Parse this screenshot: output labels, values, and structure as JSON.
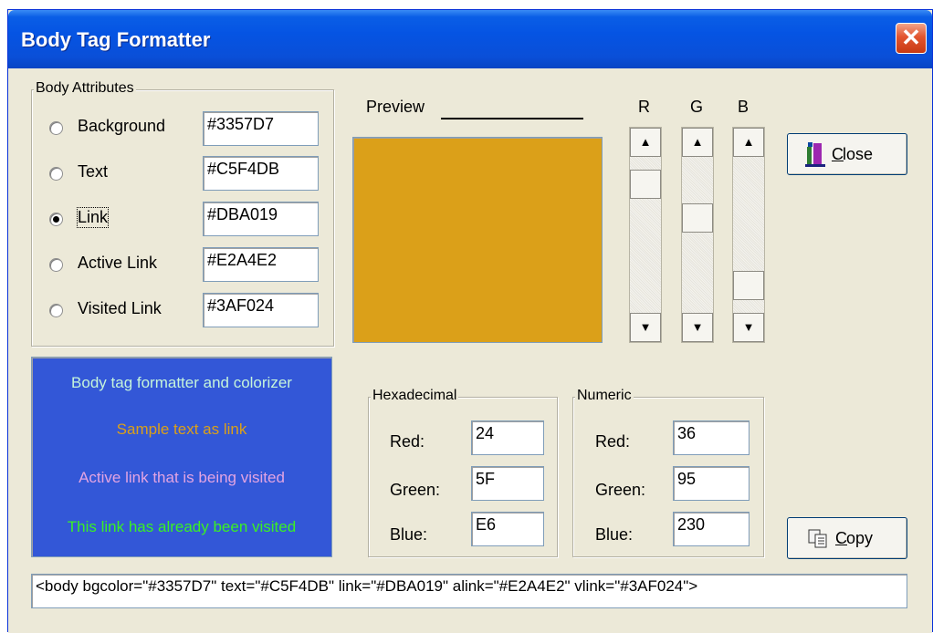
{
  "window": {
    "title": "Body Tag Formatter",
    "close_glyph": "✕"
  },
  "attributes": {
    "group_title": "Body Attributes",
    "items": [
      {
        "label": "Background",
        "value": "#3357D7",
        "selected": false
      },
      {
        "label": "Text",
        "value": "#C5F4DB",
        "selected": false
      },
      {
        "label": "Link",
        "value": "#DBA019",
        "selected": true
      },
      {
        "label": "Active Link",
        "value": "#E2A4E2",
        "selected": false
      },
      {
        "label": "Visited Link",
        "value": "#3AF024",
        "selected": false
      }
    ]
  },
  "preview": {
    "label": "Preview",
    "color": "#DBA019"
  },
  "sliders": {
    "r": {
      "label": "R",
      "level": 0.1
    },
    "g": {
      "label": "G",
      "level": 0.37
    },
    "b": {
      "label": "B",
      "level": 0.9
    }
  },
  "buttons": {
    "close_label": "Close",
    "close_mnemonic": "C",
    "copy_label": "Copy",
    "copy_mnemonic": "C"
  },
  "sample": {
    "background": "#3357D7",
    "title_text": "Body tag formatter and colorizer",
    "title_color": "#C5F4DB",
    "link_text": "Sample text as link",
    "link_color": "#DBA019",
    "active_text": "Active link that is being visited",
    "active_color": "#E2A4E2",
    "visited_text": "This link has already been visited",
    "visited_color": "#3AF024"
  },
  "hex": {
    "group_title": "Hexadecimal",
    "red_label": "Red:",
    "red": "24",
    "green_label": "Green:",
    "green": "5F",
    "blue_label": "Blue:",
    "blue": "E6"
  },
  "numeric": {
    "group_title": "Numeric",
    "red_label": "Red:",
    "red": "36",
    "green_label": "Green:",
    "green": "95",
    "blue_label": "Blue:",
    "blue": "230"
  },
  "output": {
    "value": "<body bgcolor=\"#3357D7\" text=\"#C5F4DB\" link=\"#DBA019\" alink=\"#E2A4E2\" vlink=\"#3AF024\">"
  }
}
